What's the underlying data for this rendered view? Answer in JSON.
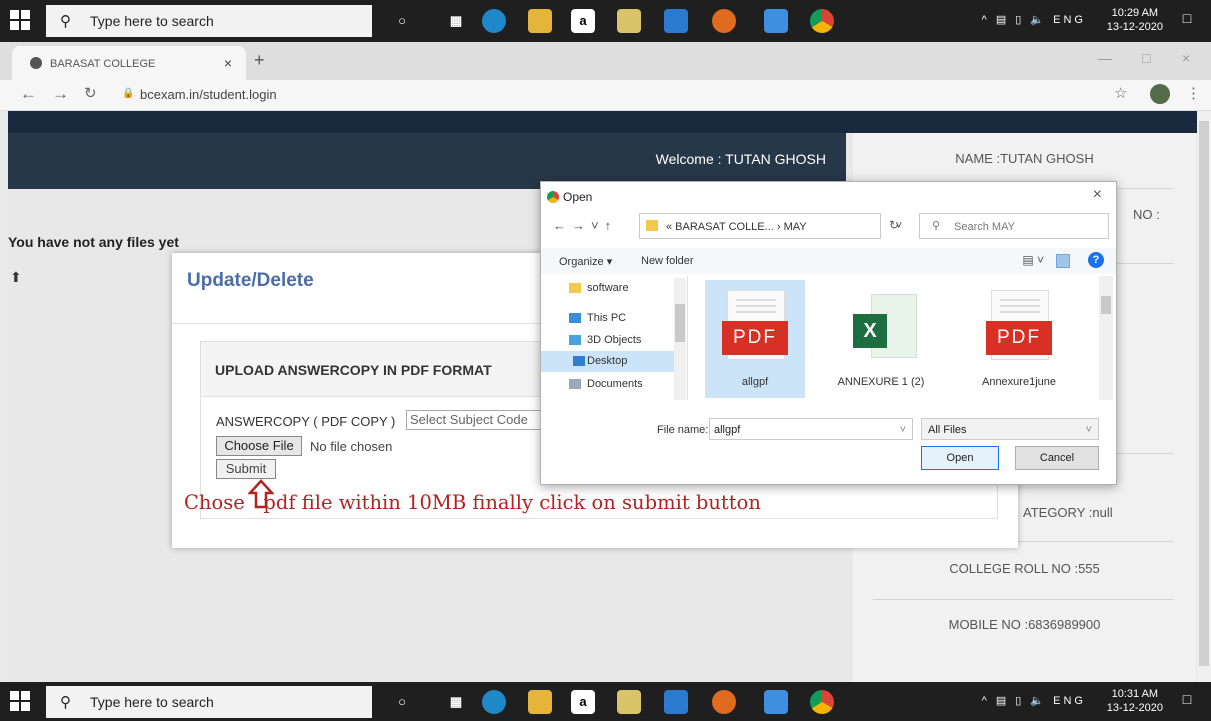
{
  "taskbar_top": {
    "search_placeholder": "Type here to search",
    "time": "10:29 AM",
    "date": "13-12-2020",
    "lang": "ENG"
  },
  "taskbar_bottom": {
    "search_placeholder": "Type here to search",
    "time": "10:31 AM",
    "date": "13-12-2020",
    "lang": "ENG"
  },
  "browser": {
    "tab_title": "BARASAT COLLEGE",
    "url": "bcexam.in/student.login"
  },
  "page": {
    "welcome": "Welcome : TUTAN GHOSH",
    "no_files": "You have not any files yet",
    "info": {
      "name": "NAME :TUTAN GHOSH",
      "no": "NO :",
      "category": "ATEGORY :null",
      "roll": "COLLEGE ROLL NO :555",
      "mobile": "MOBILE NO :6836989900"
    }
  },
  "modal": {
    "title": "Update/Delete",
    "section_title": "UPLOAD ANSWERCOPY IN PDF FORMAT",
    "answer_label": "ANSWERCOPY ( PDF COPY )",
    "subject_select": "Select Subject Code",
    "choose_file": "Choose File",
    "no_file": "No file chosen",
    "submit": "Submit",
    "instruction": "Chose   pdf file within 10MB finally click on submit button"
  },
  "open_dialog": {
    "title": "Open",
    "path": "« BARASAT COLLE... › MAY",
    "search": "Search MAY",
    "organize": "Organize ▾",
    "new_folder": "New folder",
    "tree": [
      "software",
      "This PC",
      "3D Objects",
      "Desktop",
      "Documents"
    ],
    "files": [
      "allgpf",
      "ANNEXURE 1 (2)",
      "Annexure1june"
    ],
    "pdf_label": "PDF",
    "filename_label": "File name:",
    "filename_value": "allgpf",
    "filetype": "All Files",
    "open_btn": "Open",
    "cancel_btn": "Cancel"
  },
  "colors": {
    "accent": "#4b6ea8",
    "instruction": "#b22222",
    "pdf_red": "#d93025",
    "excel_green": "#1d6f42"
  }
}
